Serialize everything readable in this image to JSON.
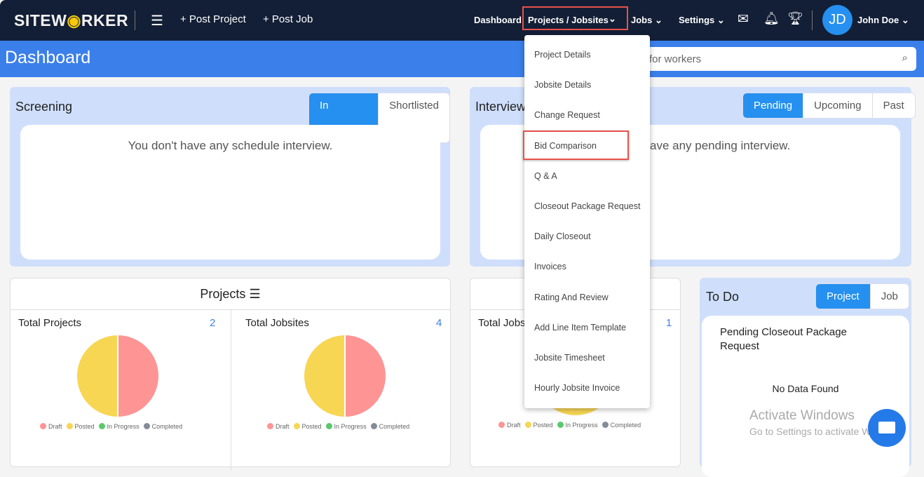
{
  "nav": {
    "logo": "SITEWORKER",
    "post_project": "+ Post Project",
    "post_job": "+ Post Job",
    "dashboard": "Dashboard",
    "projects": "Projects / Jobsites",
    "jobs": "Jobs",
    "settings": "Settings",
    "avatar": "JD",
    "user": "John Doe"
  },
  "page": {
    "title": "Dashboard",
    "search_placeholder": "Search for workers",
    "search_visible": "for workers"
  },
  "screening": {
    "title": "Screening",
    "tabs": [
      "In Pipeline",
      "Shortlisted"
    ],
    "empty": "You don't have any schedule interview."
  },
  "interview": {
    "title": "Interview",
    "tabs": [
      "Pending",
      "Upcoming",
      "Past"
    ],
    "empty": "You don't have any pending interview.",
    "empty_visible": "ave any pending interview."
  },
  "projects": {
    "title": "Projects",
    "total_projects": "Total Projects",
    "total_projects_count": "2",
    "total_jobsites": "Total Jobsites",
    "total_jobsites_count": "4"
  },
  "jobs": {
    "total_jobs": "Total Jobs",
    "total_jobs_count": "1"
  },
  "legend": [
    "Draft",
    "Posted",
    "In Progress",
    "Completed"
  ],
  "colors": {
    "draft": "#ff9494",
    "posted": "#f7d654",
    "in_progress": "#5ac96d",
    "completed": "#858c99",
    "accent": "#2590ef",
    "nav": "#131f36",
    "band": "#3b7fea"
  },
  "chart_data": [
    {
      "type": "pie",
      "title": "Total Projects",
      "categories": [
        "Draft",
        "Posted",
        "In Progress",
        "Completed"
      ],
      "values": [
        1,
        1,
        0,
        0
      ]
    },
    {
      "type": "pie",
      "title": "Total Jobsites",
      "categories": [
        "Draft",
        "Posted",
        "In Progress",
        "Completed"
      ],
      "values": [
        2,
        2,
        0,
        0
      ]
    },
    {
      "type": "pie",
      "title": "Total Jobs",
      "categories": [
        "Draft",
        "Posted",
        "In Progress",
        "Completed"
      ],
      "values": [
        0,
        1,
        0,
        0
      ]
    }
  ],
  "todo": {
    "title": "To Do",
    "tabs": [
      "Project",
      "Job"
    ],
    "item": "Pending Closeout Package Request",
    "empty": "No Data Found"
  },
  "dropdown": [
    "Project Details",
    "Jobsite Details",
    "Change Request",
    "Bid Comparison",
    "Q & A",
    "Closeout Package Request",
    "Daily Closeout",
    "Invoices",
    "Rating And Review",
    "Add Line Item Template",
    "Jobsite Timesheet",
    "Hourly Jobsite Invoice"
  ],
  "watermark": {
    "line1": "Activate Windows",
    "line2": "Go to Settings to activate Windows."
  }
}
